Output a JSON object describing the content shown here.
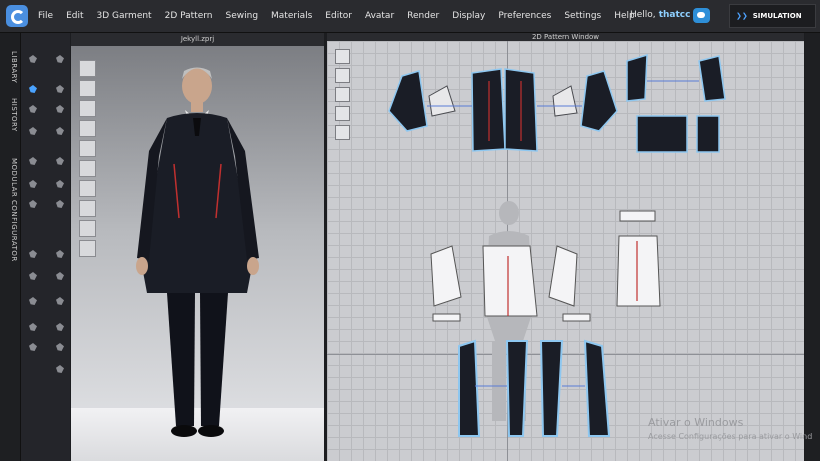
{
  "menubar": {
    "items": [
      "File",
      "Edit",
      "3D Garment",
      "2D Pattern",
      "Sewing",
      "Materials",
      "Editor",
      "Avatar",
      "Render",
      "Display",
      "Preferences",
      "Settings",
      "Help"
    ],
    "greeting": "Hello,",
    "username": "thatcc",
    "mode_label": "SIMULATION"
  },
  "left_tabs": [
    "LIBRARY",
    "HISTORY",
    "MODULAR CONFIGURATOR"
  ],
  "avatar_window": {
    "title": "Jekyll.zprj"
  },
  "pattern_window": {
    "title": "2D Pattern Window"
  },
  "watermark": {
    "title": "Ativar o Windows",
    "subtitle": "Acesse Configurações para ativar o Wind"
  },
  "colors": {
    "accent": "#4aa3ff",
    "garment": "#1a1d26",
    "pattern_outline": "#8ec7f0",
    "seam_red": "#c0302f"
  },
  "icons": [
    "app-logo-icon",
    "cloud-icon",
    "chevron-down-icon",
    "tool-icons"
  ]
}
